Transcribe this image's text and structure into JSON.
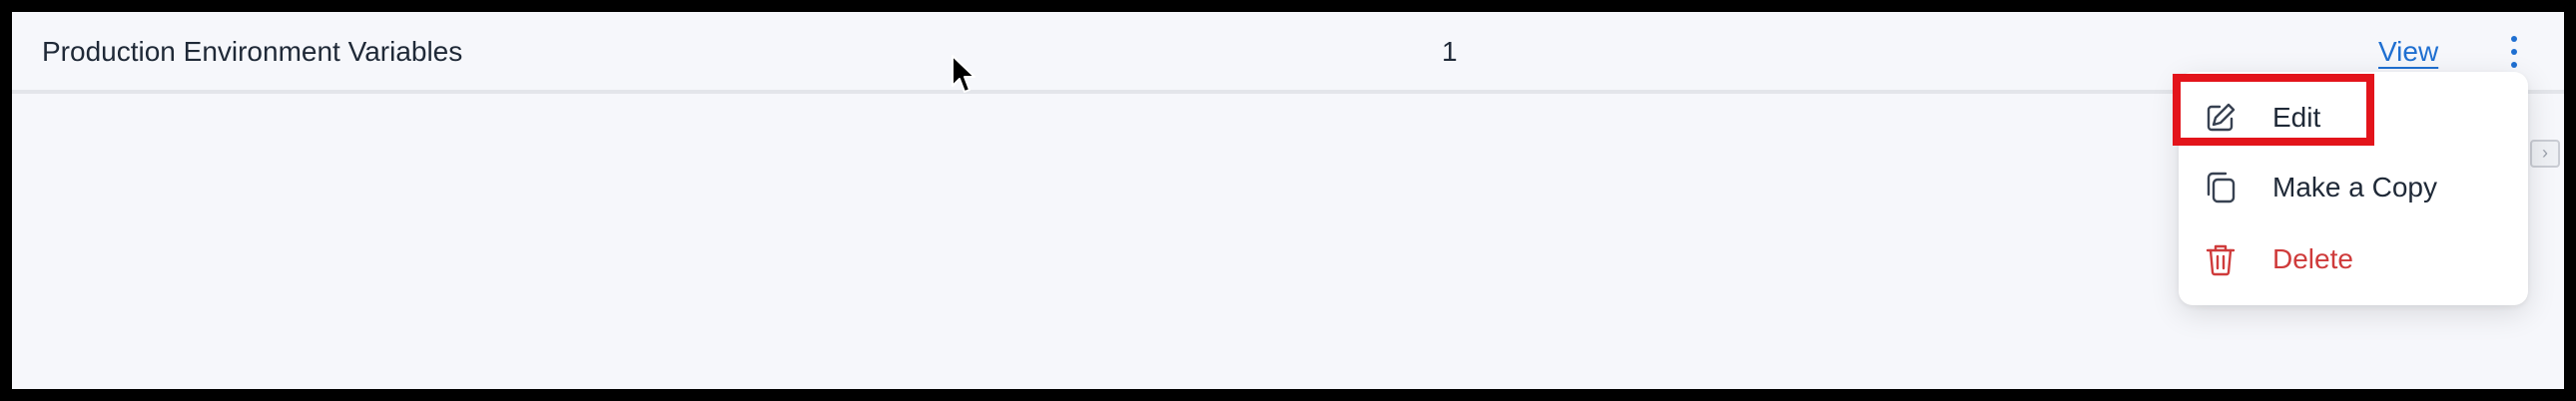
{
  "row": {
    "name": "Production Environment Variables",
    "count": "1",
    "view_label": "View"
  },
  "menu": {
    "items": [
      {
        "label": "Edit",
        "icon": "pencil-icon"
      },
      {
        "label": "Make a Copy",
        "icon": "copy-icon"
      },
      {
        "label": "Delete",
        "icon": "trash-icon"
      }
    ]
  },
  "colors": {
    "link": "#1f6fd1",
    "danger": "#cf3b3b",
    "highlight": "#e3141b",
    "background": "#f6f7fb"
  }
}
